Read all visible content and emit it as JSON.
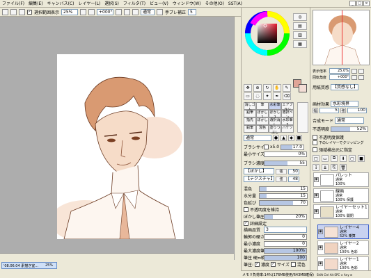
{
  "menu": [
    "ファイル(F)",
    "編集(E)",
    "キャンバス(C)",
    "レイヤー(L)",
    "選択(S)",
    "フィルタ(T)",
    "ビュー(V)",
    "ウィンドウ(W)",
    "その他(O)",
    "SST(A)"
  ],
  "toolbar": {
    "selection_label": "選択範囲表示",
    "zoom": "25%",
    "rotation": "+000°",
    "mode": "通常",
    "stabilizer_label": "手ブレ補正",
    "stabilizer_value": "5"
  },
  "navigator": {
    "zoom_label": "表示倍率",
    "zoom_value": "25.0%",
    "rotate_label": "回転角度",
    "rotate_value": "+000°"
  },
  "paper": {
    "label": "用紙質感",
    "value": "【質感なし】",
    "effect_label": "画材効果",
    "effect_value": "水彩境界",
    "width": "5",
    "strength": "100"
  },
  "blend": {
    "label": "合成モード",
    "value": "通常",
    "opacity_label": "不透明度",
    "opacity_value": "52%"
  },
  "layer_checks": [
    "不透明度保護",
    "下のレイヤーでクリッピング",
    "領域検出元に指定"
  ],
  "tools": {
    "row1": [
      "消しゴム",
      "筆",
      "水彩筆",
      "エアブラシ"
    ],
    "row2": [
      "鉛筆",
      "ぼかし1",
      "ぼかし2",
      "選択ペン"
    ],
    "row3": [
      "指先",
      "ぼかし",
      "選択消し",
      "水彩筆2"
    ],
    "row4": [
      "鉛筆",
      "混色",
      "塗りつぶし",
      "バケツ"
    ]
  },
  "brush": {
    "mode": "通常",
    "size_label": "ブラシサイズ",
    "size_mult": "x5.0",
    "size_value": "17.0",
    "min_label": "最小サイズ",
    "min_value": "0%",
    "density_label": "ブラシ濃度",
    "density_value": "55",
    "blur_shape": "【ぼかし】",
    "blur_val": "50",
    "texture": "【テクスチャ】",
    "texture_val": "48"
  },
  "mix": {
    "mix_label": "混色",
    "mix_value": "15",
    "water_label": "水分量",
    "water_value": "15",
    "ext_label": "色延び",
    "ext_value": "70",
    "keep_opacity": "不透明度を維持",
    "blur_pressure_label": "ぼかし筆圧",
    "blur_pressure_value": "20%"
  },
  "detail": {
    "label": "詳細設定",
    "quality_label": "描画品質",
    "quality_value": "3",
    "edge_label": "輪郭の硬さ",
    "edge_value": "0",
    "min_density_label": "最小濃度",
    "min_density_value": "0",
    "max_pressure_label": "最大濃度筆圧",
    "max_pressure_value": "100%",
    "pressure_label": "筆圧 硬⇔軟",
    "pressure_value": "100",
    "press_label": "筆圧:",
    "press_density": "濃度",
    "press_size": "サイズ",
    "press_mix": "混色"
  },
  "layers": [
    {
      "name": "パレット",
      "mode": "通常",
      "opacity": "100%"
    },
    {
      "name": "線画",
      "mode": "通常",
      "opacity": "100% 保護"
    },
    {
      "name": "レイヤーセット1",
      "mode": "通常",
      "opacity": "100% 開閉"
    },
    {
      "name": "レイヤー4",
      "mode": "通常",
      "opacity": "52% 乗算"
    },
    {
      "name": "レイヤー2",
      "mode": "通常",
      "opacity": "100% 色彩"
    },
    {
      "name": "レイヤー1",
      "mode": "通常",
      "opacity": "100% 色彩"
    }
  ],
  "status": {
    "memory": "メモリ負荷率:14%(176MB使用/643MB確保)",
    "keys": "Shift Ctrl Alt SPC ⊙ Any ⊟"
  },
  "doc": {
    "title": "'08.06.04 素描き室...",
    "zoom": "25%"
  },
  "colors": {
    "fg": "#e0a597",
    "bg": "#f3ddd5"
  }
}
